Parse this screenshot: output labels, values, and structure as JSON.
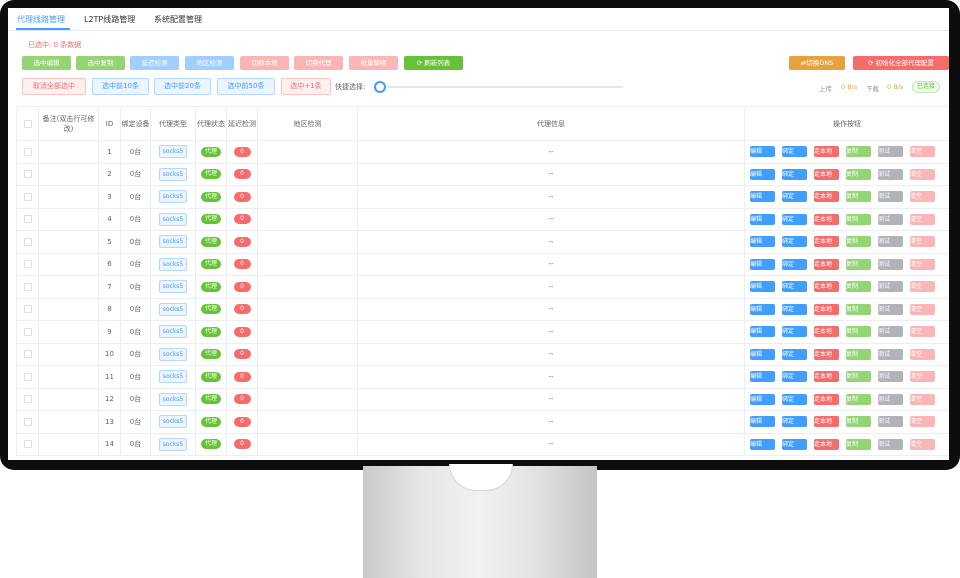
{
  "tabs": [
    "代理线路管理",
    "L2TP线路管理",
    "系统配置管理"
  ],
  "selected_info": "已选中: 0 条数据",
  "toolbar_row1": [
    "选中编辑",
    "选中复制",
    "延迟检测",
    "地区检测",
    "切换本地",
    "切换代理",
    "批量解绑"
  ],
  "refresh_label": "刷新列表",
  "switch_dns_label": "切换DNS",
  "init_config_label": "初始化全部代理配置",
  "select_buttons": [
    "取消全部选中",
    "选中前10条",
    "选中前20条",
    "选中前50条",
    "选中+1条"
  ],
  "quick_select_label": "快捷选择:",
  "quick_select_value": 0,
  "upload_label": "上传",
  "upload_value": "0 B/s",
  "download_label": "下载",
  "download_value": "0 B/s",
  "connection_status": "已连接",
  "columns": [
    "备注(双击行可修改)",
    "ID",
    "绑定设备",
    "代理类型",
    "代理状态",
    "延迟检测",
    "地区检测",
    "代理信息",
    "操作按钮"
  ],
  "row_action_labels": [
    "编辑",
    "绑定",
    "走本地",
    "复制",
    "测试",
    "清空"
  ],
  "rows": [
    {
      "id": "1",
      "device": "0台",
      "type": "socks5",
      "status": "代理",
      "latency": "0",
      "region": "",
      "info": "--"
    },
    {
      "id": "2",
      "device": "0台",
      "type": "socks5",
      "status": "代理",
      "latency": "0",
      "region": "",
      "info": "--"
    },
    {
      "id": "3",
      "device": "0台",
      "type": "socks5",
      "status": "代理",
      "latency": "0",
      "region": "",
      "info": "--"
    },
    {
      "id": "4",
      "device": "0台",
      "type": "socks5",
      "status": "代理",
      "latency": "0",
      "region": "",
      "info": "--"
    },
    {
      "id": "5",
      "device": "0台",
      "type": "socks5",
      "status": "代理",
      "latency": "0",
      "region": "",
      "info": "--"
    },
    {
      "id": "6",
      "device": "0台",
      "type": "socks5",
      "status": "代理",
      "latency": "0",
      "region": "",
      "info": "--"
    },
    {
      "id": "7",
      "device": "0台",
      "type": "socks5",
      "status": "代理",
      "latency": "0",
      "region": "",
      "info": "--"
    },
    {
      "id": "8",
      "device": "0台",
      "type": "socks5",
      "status": "代理",
      "latency": "0",
      "region": "",
      "info": "--"
    },
    {
      "id": "9",
      "device": "0台",
      "type": "socks5",
      "status": "代理",
      "latency": "0",
      "region": "",
      "info": "--"
    },
    {
      "id": "10",
      "device": "0台",
      "type": "socks5",
      "status": "代理",
      "latency": "0",
      "region": "",
      "info": "--"
    },
    {
      "id": "11",
      "device": "0台",
      "type": "socks5",
      "status": "代理",
      "latency": "0",
      "region": "",
      "info": "--"
    },
    {
      "id": "12",
      "device": "0台",
      "type": "socks5",
      "status": "代理",
      "latency": "0",
      "region": "",
      "info": "--"
    },
    {
      "id": "13",
      "device": "0台",
      "type": "socks5",
      "status": "代理",
      "latency": "0",
      "region": "",
      "info": "--"
    },
    {
      "id": "14",
      "device": "0台",
      "type": "socks5",
      "status": "代理",
      "latency": "0",
      "region": "",
      "info": "--"
    }
  ],
  "colors": {
    "primary": "#409eff",
    "success": "#67c23a",
    "danger": "#f56c6c",
    "warning": "#e6a23c"
  }
}
